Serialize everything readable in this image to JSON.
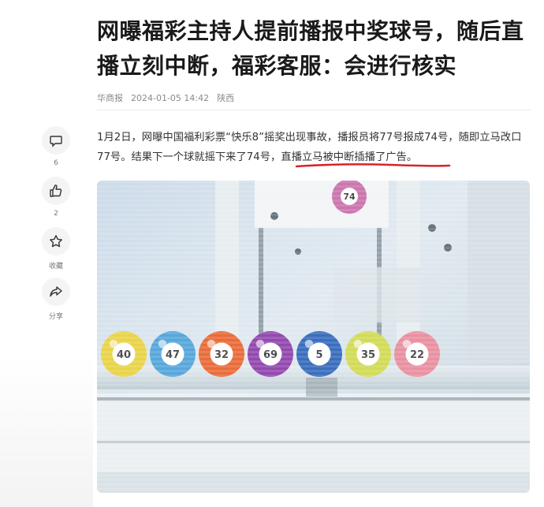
{
  "article": {
    "title": "网曝福彩主持人提前播报中奖球号，随后直播立刻中断，福彩客服：会进行核实",
    "source": "华商报",
    "date": "2024-01-05 14:42",
    "region": "陕西",
    "body_part1": "1月2日，网曝中国福利彩票“快乐8”摇奖出现事故，播报员将77号报成74号，随即立马改口77号。结果下一个球就摇下来了74号，",
    "body_highlight": "直播立马被中断插播了广告。"
  },
  "sidebar": {
    "comment_count": "6",
    "like_count": "2",
    "favorite_label": "收藏",
    "share_label": "分享"
  },
  "balls": [
    {
      "number": "40",
      "color": "#e8d03a"
    },
    {
      "number": "47",
      "color": "#4aa0d8"
    },
    {
      "number": "32",
      "color": "#e8602a"
    },
    {
      "number": "69",
      "color": "#8a3aa8"
    },
    {
      "number": "5",
      "color": "#2a62b8"
    },
    {
      "number": "35",
      "color": "#cfd84a"
    },
    {
      "number": "22",
      "color": "#e8889a"
    }
  ],
  "top_ball": {
    "number": "74",
    "color": "#c86aa8"
  },
  "colors": {
    "underline": "#d4252a",
    "title": "#1a1a1a",
    "meta": "#8a8a8a"
  }
}
